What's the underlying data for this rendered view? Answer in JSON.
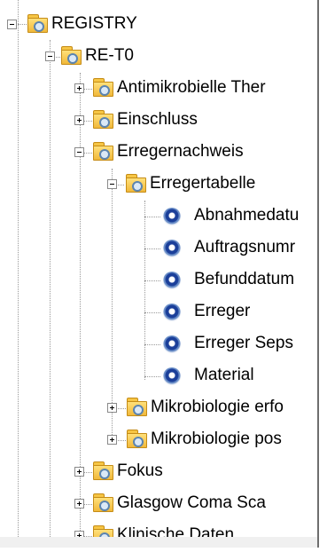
{
  "tree": {
    "root": {
      "label": "REGISTRY",
      "expanded": true
    },
    "re_t0": {
      "label": "RE-T0",
      "expanded": true
    },
    "items": [
      {
        "label": "Antimikrobielle Ther",
        "expanded": false
      },
      {
        "label": "Einschluss",
        "expanded": false
      },
      {
        "label": "Erregernachweis",
        "expanded": true
      },
      {
        "label": "Erregertabelle",
        "expanded": true
      },
      {
        "label": "Abnahmedatu"
      },
      {
        "label": "Auftragsnumr"
      },
      {
        "label": "Befunddatum"
      },
      {
        "label": "Erreger"
      },
      {
        "label": "Erreger Seps"
      },
      {
        "label": "Material"
      },
      {
        "label": "Mikrobiologie erfo",
        "expanded": false
      },
      {
        "label": "Mikrobiologie pos",
        "expanded": false
      },
      {
        "label": "Fokus",
        "expanded": false
      },
      {
        "label": "Glasgow Coma Sca",
        "expanded": false
      },
      {
        "label": "Klinische Daten",
        "expanded": false
      }
    ]
  },
  "icons": {
    "folder": "folder-search-icon",
    "leaf": "data-field-icon",
    "expanded": "collapse-minus-icon",
    "collapsed": "expand-plus-icon"
  }
}
